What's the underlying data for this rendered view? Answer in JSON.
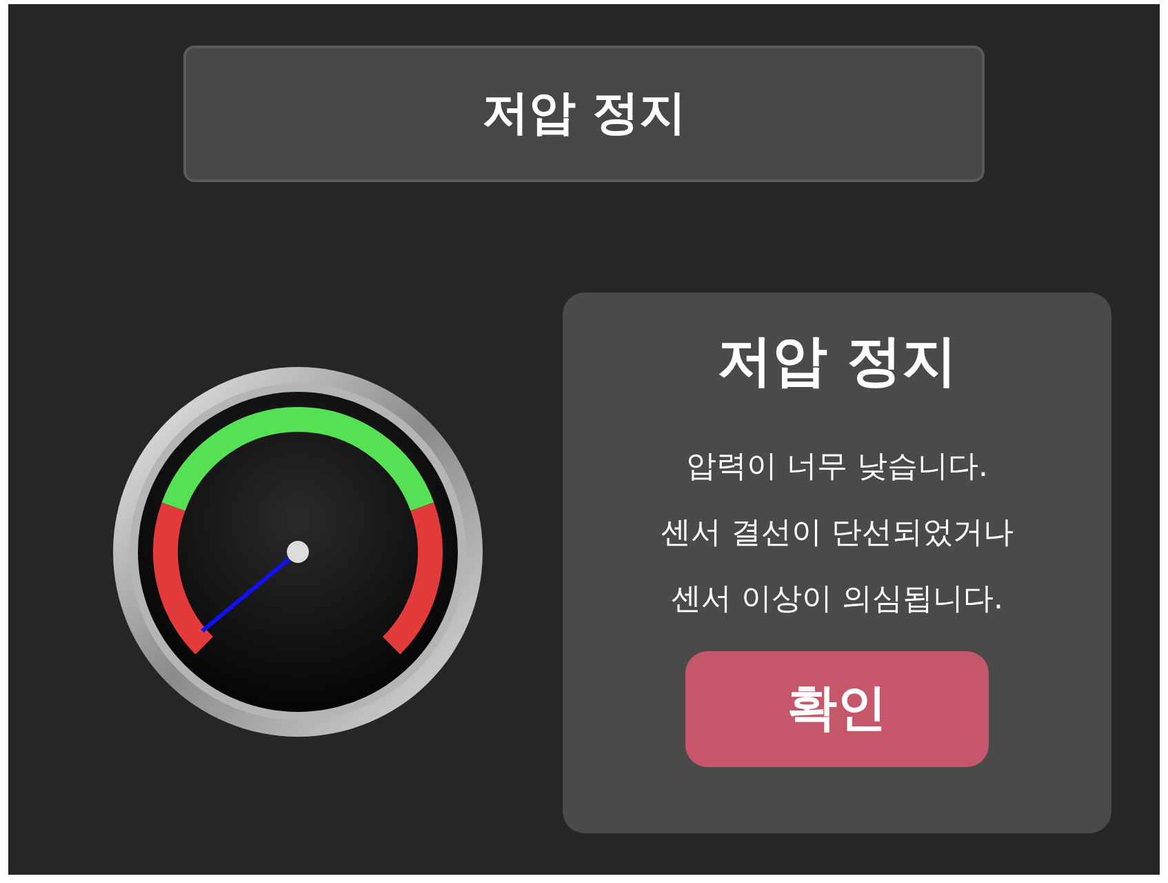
{
  "header": {
    "title": "저압 정지"
  },
  "dialog": {
    "title": "저압 정지",
    "message_lines": [
      "압력이 너무 낮습니다.",
      "센서 결선이 단선되었거나",
      "센서 이상이 의심됩니다."
    ],
    "button": "확인"
  }
}
